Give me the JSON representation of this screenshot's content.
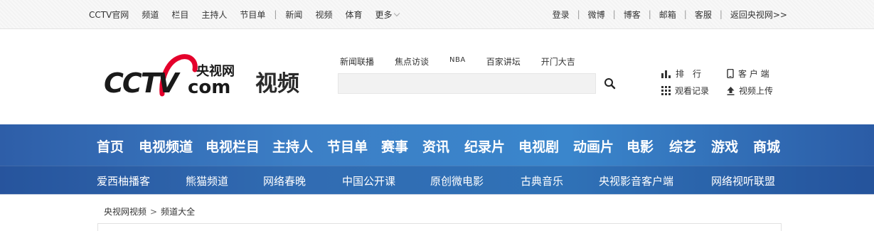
{
  "topbar": {
    "left_links": [
      "CCTV官网",
      "频道",
      "栏目",
      "主持人",
      "节目单"
    ],
    "separator": "|",
    "mid_links": [
      "新闻",
      "视频",
      "体育"
    ],
    "more_label": "更多",
    "right_links": [
      "登录",
      "微博",
      "博客",
      "邮箱",
      "客服",
      "返回央视网>>"
    ]
  },
  "logo": {
    "cctv_text": "CCTV",
    "cn_text": "央视网",
    "com_text": "com",
    "section_text": "视频",
    "brand_red": "#e4002b",
    "brand_black": "#1a1a1a"
  },
  "search": {
    "hot_links": [
      "新闻联播",
      "焦点访谈",
      "NBA",
      "百家讲坛",
      "开门大吉"
    ],
    "placeholder": "",
    "value": "",
    "button_icon": "search-icon"
  },
  "quick_links": {
    "rank": "排　行",
    "client": "客 户 端",
    "history": "观看记录",
    "upload": "视频上传"
  },
  "nav": {
    "primary": [
      "首页",
      "电视频道",
      "电视栏目",
      "主持人",
      "节目单",
      "赛事",
      "资讯",
      "纪录片",
      "电视剧",
      "动画片",
      "电影",
      "综艺",
      "游戏",
      "商城"
    ],
    "secondary": [
      "爱西柚播客",
      "熊猫频道",
      "网络春晚",
      "中国公开课",
      "原创微电影",
      "古典音乐",
      "央视影音客户端",
      "网络视听联盟"
    ],
    "bg_color": "#3a7bc4"
  },
  "breadcrumb": {
    "home": "央视网视频",
    "separator": ">",
    "current": "频道大全"
  }
}
